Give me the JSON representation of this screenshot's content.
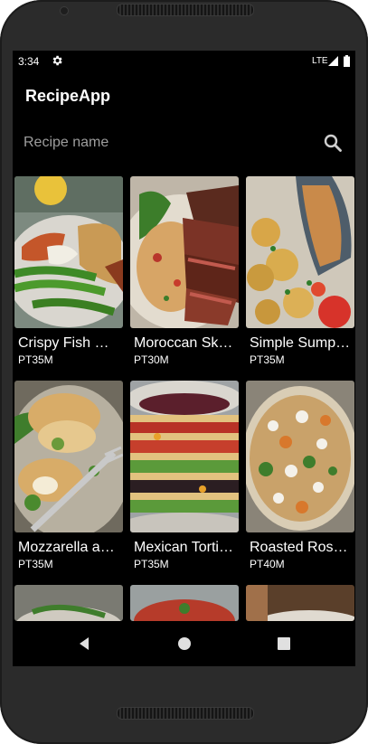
{
  "status_bar": {
    "time": "3:34",
    "network": "LTE",
    "icons": [
      "gear-icon",
      "signal-icon",
      "battery-icon"
    ]
  },
  "app": {
    "title": "RecipeApp"
  },
  "search": {
    "placeholder": "Recipe name",
    "icon": "search-icon"
  },
  "recipes": [
    {
      "name": "Crispy Fish Goujons",
      "time": "PT35M"
    },
    {
      "name": "Moroccan Skirt Steak",
      "time": "PT30M"
    },
    {
      "name": "Simple Sumptuous Sea Bass",
      "time": "PT35M"
    },
    {
      "name": "Mozzarella and Chicken",
      "time": "PT35M"
    },
    {
      "name": "Mexican Tortilla Lasagne",
      "time": "PT35M"
    },
    {
      "name": "Roasted Rosemary Orzo",
      "time": "PT40M"
    }
  ],
  "nav_bar": {
    "icons": [
      "back-icon",
      "home-icon",
      "recents-icon"
    ]
  },
  "colors": {
    "screen_background": "#000000",
    "text": "#ffffff",
    "placeholder": "#9e9e9e",
    "device_frame": "#2b2b2b"
  }
}
